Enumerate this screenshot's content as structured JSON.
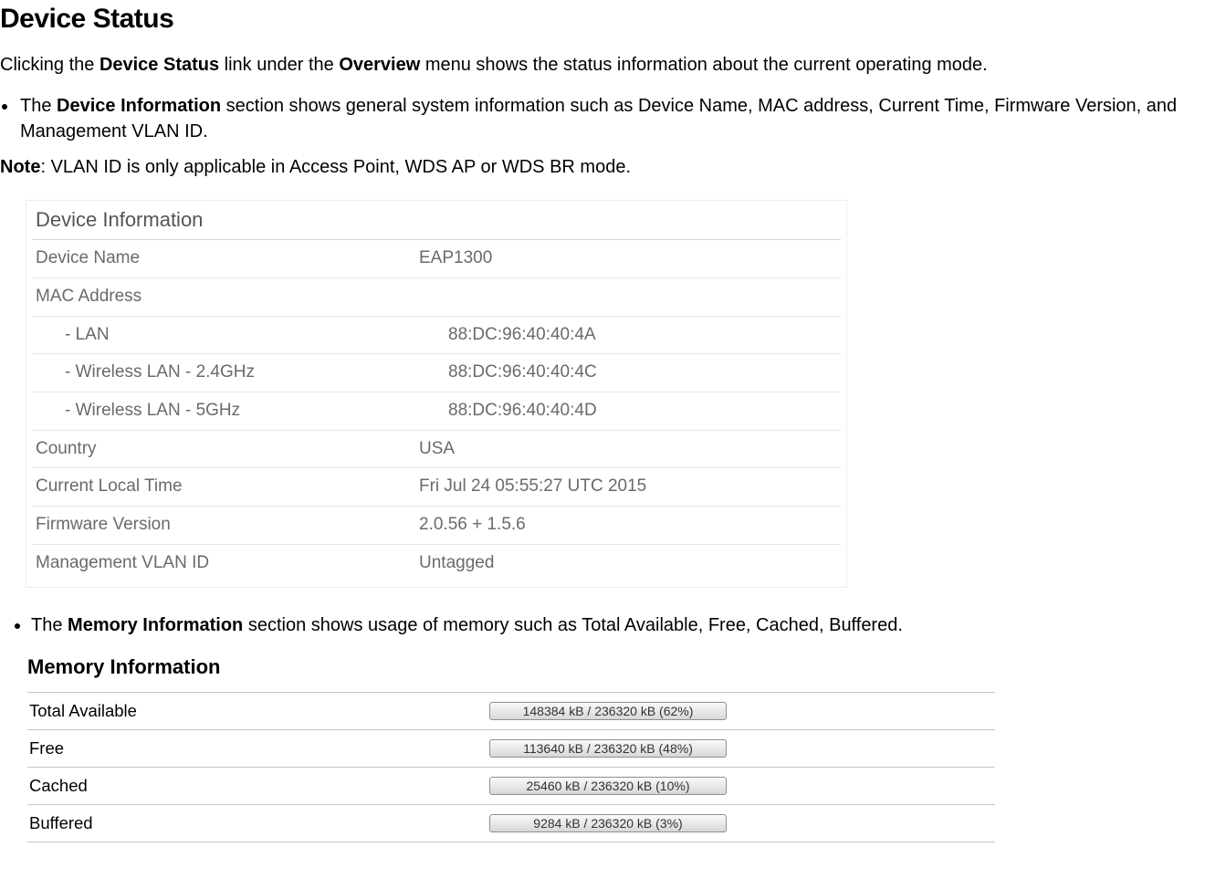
{
  "title": "Device Status",
  "intro": {
    "pre": "Clicking the ",
    "link1": "Device Status",
    "mid": " link under the ",
    "link2": "Overview",
    "post": " menu shows the status information about the current operating mode."
  },
  "bullet1": {
    "pre": "The ",
    "bold": "Device Information",
    "post": " section shows general system information such as Device Name, MAC address, Current Time, Firmware Version, and Management VLAN ID."
  },
  "note": {
    "label": "Note",
    "text": ": VLAN ID is only applicable in Access Point, WDS AP or WDS BR mode."
  },
  "device_info": {
    "header": "Device Information",
    "rows": {
      "device_name_label": "Device Name",
      "device_name_value": "EAP1300",
      "mac_label": "MAC Address",
      "lan_label": "- LAN",
      "lan_value": "88:DC:96:40:40:4A",
      "w24_label": "- Wireless LAN - 2.4GHz",
      "w24_value": "88:DC:96:40:40:4C",
      "w5_label": "- Wireless LAN - 5GHz",
      "w5_value": "88:DC:96:40:40:4D",
      "country_label": "Country",
      "country_value": "USA",
      "time_label": "Current Local Time",
      "time_value": "Fri Jul 24 05:55:27 UTC 2015",
      "fw_label": "Firmware Version",
      "fw_value": "2.0.56 + 1.5.6",
      "vlan_label": "Management VLAN ID",
      "vlan_value": "Untagged"
    }
  },
  "bullet2": {
    "pre": "The ",
    "bold": "Memory Information",
    "post": " section shows usage of memory such as Total Available, Free, Cached, Buffered."
  },
  "memory_info": {
    "header": "Memory Information",
    "rows": {
      "total_label": "Total Available",
      "total_value": "148384 kB / 236320 kB (62%)",
      "free_label": "Free",
      "free_value": "113640 kB / 236320 kB (48%)",
      "cached_label": "Cached",
      "cached_value": "25460 kB / 236320 kB (10%)",
      "buffered_label": "Buffered",
      "buffered_value": "9284 kB / 236320 kB (3%)"
    }
  }
}
